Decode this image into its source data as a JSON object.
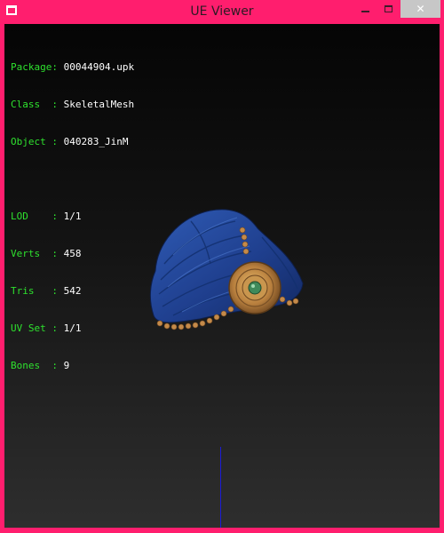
{
  "window": {
    "title": "UE Viewer",
    "controls": {
      "minimize": "minimize",
      "maximize": "maximize",
      "close": "✕"
    },
    "colors": {
      "frame": "#ff1e6e",
      "close_button": "#c7c7c7"
    }
  },
  "viewer": {
    "info": [
      {
        "key": "Package:",
        "value": "00044904.upk"
      },
      {
        "key": "Class  :",
        "value": "SkeletalMesh"
      },
      {
        "key": "Object :",
        "value": "040283_JinM"
      },
      {
        "key": "",
        "value": ""
      },
      {
        "key": "LOD    :",
        "value": "1/1"
      },
      {
        "key": "Verts  :",
        "value": "458"
      },
      {
        "key": "Tris   :",
        "value": "542"
      },
      {
        "key": "UV Set :",
        "value": "1/1"
      },
      {
        "key": "Bones  :",
        "value": "9"
      }
    ],
    "colors": {
      "label": "#2ee12e",
      "value": "#ffffff",
      "axis": "#1c1cd6"
    },
    "mesh": {
      "description_icon": "turban-mesh"
    }
  }
}
